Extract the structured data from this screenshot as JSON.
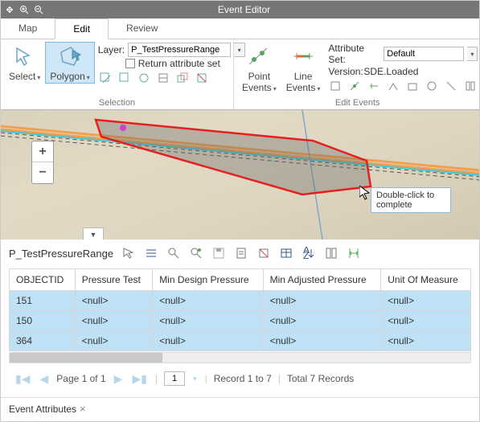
{
  "window": {
    "title": "Event Editor"
  },
  "tabs": {
    "items": [
      "Map",
      "Edit",
      "Review"
    ],
    "active": 1
  },
  "ribbon": {
    "selection": {
      "select_label": "Select",
      "polygon_label": "Polygon",
      "layer_label": "Layer:",
      "layer_value": "P_TestPressureRange",
      "return_attr_label": "Return attribute set",
      "group_label": "Selection"
    },
    "edit_events": {
      "point_label": "Point\nEvents",
      "line_label": "Line\nEvents",
      "attr_set_label": "Attribute Set:",
      "attr_set_value": "Default",
      "version_label": "Version:",
      "version_value": "SDE.Loaded",
      "group_label": "Edit Events"
    }
  },
  "map": {
    "tooltip": "Double-click to complete"
  },
  "attributes": {
    "title": "P_TestPressureRange",
    "columns": [
      "OBJECTID",
      "Pressure Test",
      "Min Design Pressure",
      "Min Adjusted Pressure",
      "Unit Of Measure"
    ],
    "rows": [
      {
        "id": "151",
        "vals": [
          "<null>",
          "<null>",
          "<null>",
          "<null>"
        ]
      },
      {
        "id": "150",
        "vals": [
          "<null>",
          "<null>",
          "<null>",
          "<null>"
        ]
      },
      {
        "id": "364",
        "vals": [
          "<null>",
          "<null>",
          "<null>",
          "<null>"
        ]
      }
    ],
    "pager": {
      "page_label": "Page 1 of 1",
      "page_input": "1",
      "record_label": "Record 1 to 7",
      "total_label": "Total 7 Records"
    }
  },
  "bottom_tab": {
    "label": "Event Attributes"
  }
}
